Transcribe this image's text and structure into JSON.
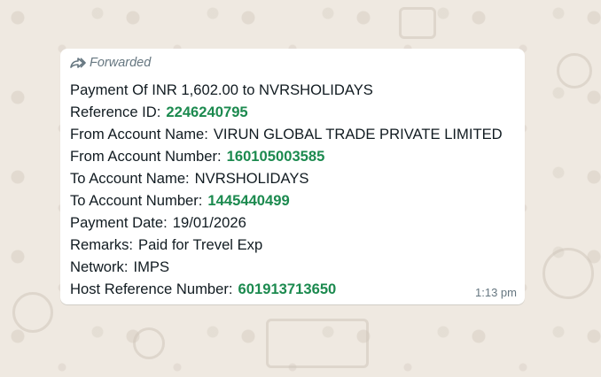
{
  "message": {
    "forwarded_label": "Forwarded",
    "title": "Payment Of INR 1,602.00 to NVRSHOLIDAYS",
    "fields": {
      "reference_id": {
        "label": "Reference ID:",
        "value": "2246240795"
      },
      "from_account_name": {
        "label": "From Account Name:",
        "value": "VIRUN GLOBAL TRADE PRIVATE LIMITED"
      },
      "from_account_number": {
        "label": "From Account Number:",
        "value": "160105003585"
      },
      "to_account_name": {
        "label": "To Account Name:",
        "value": "NVRSHOLIDAYS"
      },
      "to_account_number": {
        "label": "To Account Number:",
        "value": "1445440499"
      },
      "payment_date": {
        "label": "Payment Date:",
        "value": "19/01/2026"
      },
      "remarks": {
        "label": "Remarks:",
        "value": "Paid for Trevel Exp"
      },
      "network": {
        "label": "Network:",
        "value": "IMPS"
      },
      "host_reference_number": {
        "label": "Host Reference Number:",
        "value": "601913713650"
      }
    },
    "timestamp": "1:13 pm"
  },
  "colors": {
    "background": "#efe9e1",
    "bubble": "#ffffff",
    "link_number": "#1c8a4f",
    "text": "#111b21",
    "meta": "#667781"
  },
  "icons": {
    "forwarded": "forward-arrow-icon"
  }
}
